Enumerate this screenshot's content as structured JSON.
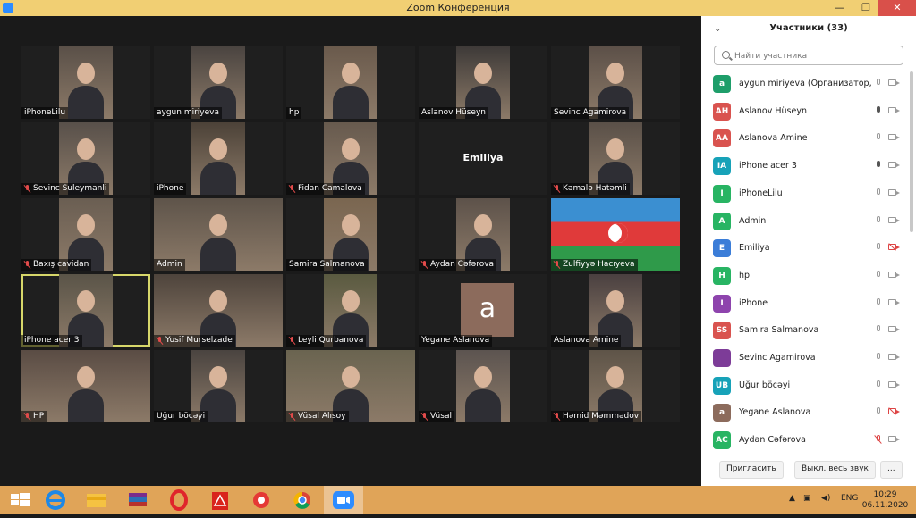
{
  "window": {
    "title": "Zoom Конференция",
    "minimize": "—",
    "restore": "❐",
    "close": "✕"
  },
  "tiles": [
    {
      "label": "iPhoneLilu",
      "muted": false
    },
    {
      "label": "aygun miriyeva",
      "muted": false
    },
    {
      "label": "hp",
      "muted": false
    },
    {
      "label": "Aslanov Hüseyn",
      "muted": false
    },
    {
      "label": "Sevinc Agamirova",
      "muted": false
    },
    {
      "label": "Sevinc Suleymanli",
      "muted": true
    },
    {
      "label": "iPhone",
      "muted": false
    },
    {
      "label": "Fidan Camalova",
      "muted": true
    },
    {
      "label": "Emiliya",
      "muted": false
    },
    {
      "label": "Kəmalə Hatəmli",
      "muted": true
    },
    {
      "label": "Baxış cavidan",
      "muted": true
    },
    {
      "label": "Admin",
      "muted": false
    },
    {
      "label": "Samira Salmanova",
      "muted": false
    },
    {
      "label": "Aydan Cəfərova",
      "muted": true
    },
    {
      "label": "Zulfiyyə Hacıyeva",
      "muted": true
    },
    {
      "label": "iPhone acer 3",
      "muted": false
    },
    {
      "label": "Yusif  Murselzade",
      "muted": true
    },
    {
      "label": "Leyli Qurbanova",
      "muted": true
    },
    {
      "label": "Yegane Aslanova",
      "muted": false,
      "avatar": "a"
    },
    {
      "label": "Aslanova Amine",
      "muted": false
    },
    {
      "label": "HP",
      "muted": true
    },
    {
      "label": "Uğur böcəyi",
      "muted": false
    },
    {
      "label": "Vüsal Alısoy",
      "muted": true
    },
    {
      "label": "Vüsal",
      "muted": true
    },
    {
      "label": "Həmid Məmmədov",
      "muted": true
    }
  ],
  "panel": {
    "header": "Участники (33)",
    "search_placeholder": "Найти участника",
    "invite": "Пригласить",
    "mute_all": "Выкл. весь звук",
    "more": "..."
  },
  "participants": [
    {
      "initials": "a",
      "name": "aygun miriyeva (Организатор, я)",
      "color": "#1e9e6a",
      "mic": "idle",
      "cam": "on"
    },
    {
      "initials": "AH",
      "name": "Aslanov Hüseyn",
      "color": "#d9534f",
      "mic": "on",
      "cam": "on"
    },
    {
      "initials": "AA",
      "name": "Aslanova Amine",
      "color": "#d9534f",
      "mic": "idle",
      "cam": "on"
    },
    {
      "initials": "IA",
      "name": "iPhone acer 3",
      "color": "#17a2b8",
      "mic": "on",
      "cam": "on"
    },
    {
      "initials": "I",
      "name": "iPhoneLilu",
      "color": "#28b463",
      "mic": "idle",
      "cam": "on"
    },
    {
      "initials": "A",
      "name": "Admin",
      "color": "#28b463",
      "mic": "idle",
      "cam": "on"
    },
    {
      "initials": "E",
      "name": "Emiliya",
      "color": "#3b7dd8",
      "mic": "idle",
      "cam": "off"
    },
    {
      "initials": "H",
      "name": "hp",
      "color": "#28b463",
      "mic": "idle",
      "cam": "on"
    },
    {
      "initials": "I",
      "name": "iPhone",
      "color": "#8e44ad",
      "mic": "idle",
      "cam": "on"
    },
    {
      "initials": "SS",
      "name": "Samira Salmanova",
      "color": "#d9534f",
      "mic": "idle",
      "cam": "on"
    },
    {
      "initials": "",
      "name": "Sevinc Agamirova",
      "color": "#7d3c98",
      "mic": "idle",
      "cam": "on"
    },
    {
      "initials": "UB",
      "name": "Uğur böcəyi",
      "color": "#17a2b8",
      "mic": "idle",
      "cam": "on"
    },
    {
      "initials": "a",
      "name": "Yegane Aslanova",
      "color": "#8c6b5c",
      "mic": "idle",
      "cam": "off"
    },
    {
      "initials": "AC",
      "name": "Aydan Cəfərova",
      "color": "#28b463",
      "mic": "off",
      "cam": "on"
    }
  ],
  "taskbar": {
    "lang": "ENG",
    "time": "10:29",
    "date": "06.11.2020"
  }
}
